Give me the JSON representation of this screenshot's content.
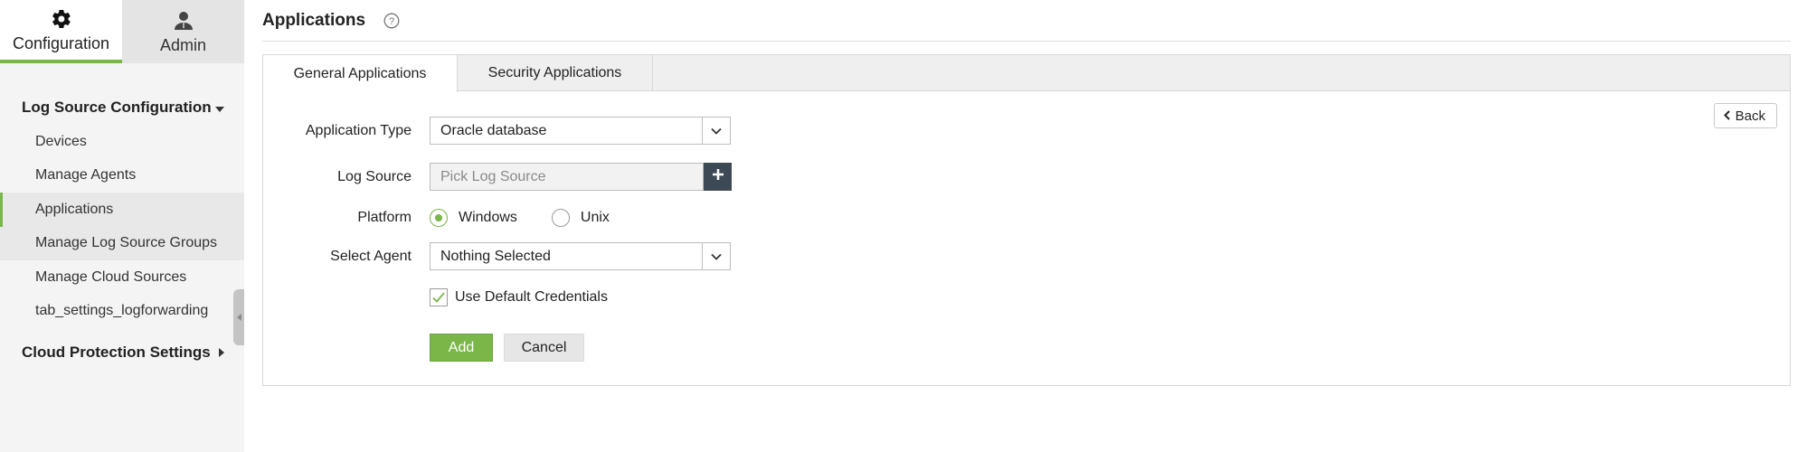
{
  "top_tabs": [
    {
      "label": "Configuration",
      "icon": "gear-icon",
      "active": true
    },
    {
      "label": "Admin",
      "icon": "user-icon",
      "active": false
    }
  ],
  "sidebar": {
    "group1": {
      "label": "Log Source Configuration",
      "expanded": true
    },
    "items": [
      {
        "label": "Devices"
      },
      {
        "label": "Manage Agents"
      },
      {
        "label": "Applications",
        "active": true
      },
      {
        "label": "Manage Log Source Groups"
      },
      {
        "label": "Manage Cloud Sources"
      },
      {
        "label": "tab_settings_logforwarding"
      }
    ],
    "group2": {
      "label": "Cloud Protection Settings",
      "expanded": false
    }
  },
  "page": {
    "title": "Applications",
    "help_icon": "question-circle-icon"
  },
  "tabs": [
    {
      "label": "General Applications",
      "active": true
    },
    {
      "label": "Security Applications",
      "active": false
    }
  ],
  "back_label": "Back",
  "form": {
    "application_type": {
      "label": "Application Type",
      "value": "Oracle database"
    },
    "log_source": {
      "label": "Log Source",
      "placeholder": "Pick Log Source"
    },
    "platform": {
      "label": "Platform",
      "options": [
        {
          "label": "Windows",
          "selected": true
        },
        {
          "label": "Unix",
          "selected": false
        }
      ]
    },
    "select_agent": {
      "label": "Select Agent",
      "value": "Nothing Selected"
    },
    "use_default_credentials": {
      "label": "Use Default Credentials",
      "checked": true
    },
    "add_label": "Add",
    "cancel_label": "Cancel"
  },
  "colors": {
    "accent_green": "#7ab648",
    "dark_button": "#3d4a56",
    "sidebar_bg": "#f4f4f4"
  }
}
